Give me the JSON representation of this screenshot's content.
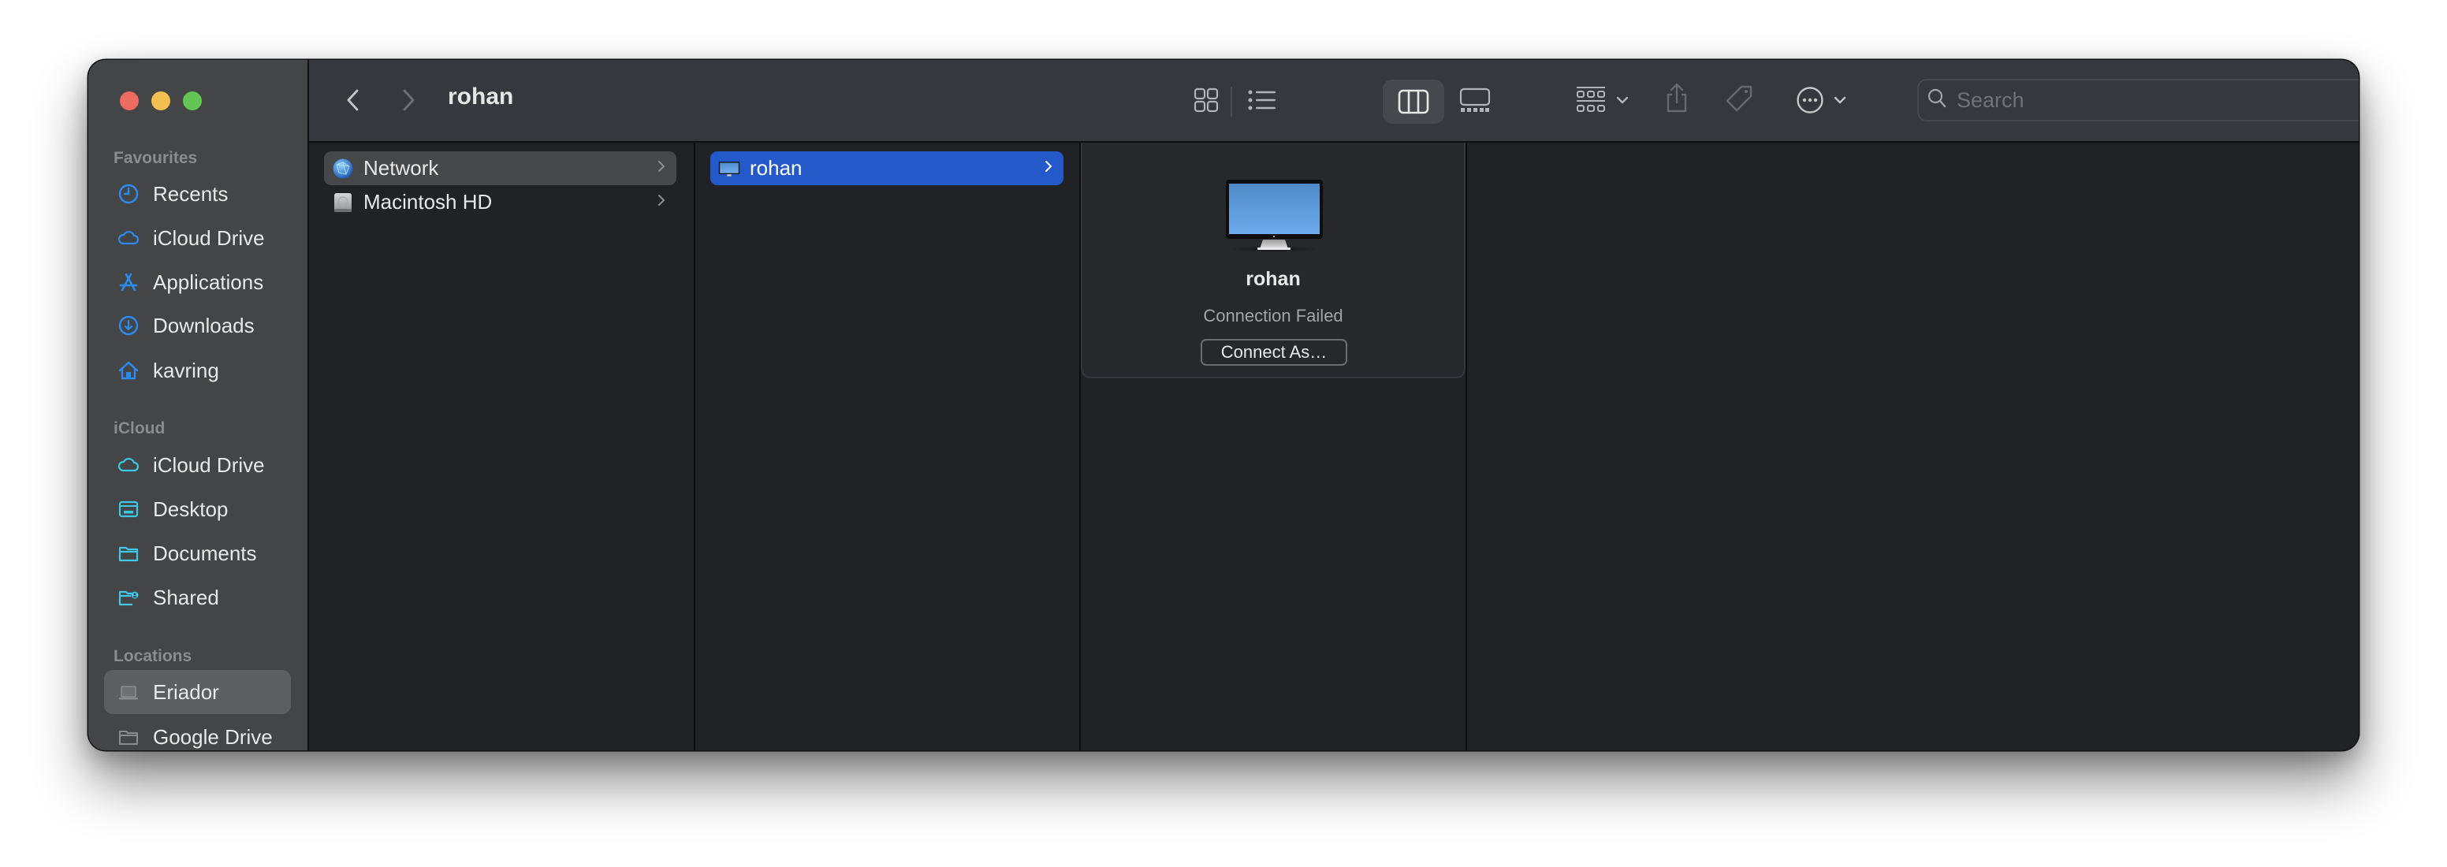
{
  "window": {
    "title": "rohan",
    "traffic_lights": {
      "close": "#ec6a5e",
      "minimize": "#f4bf4f",
      "maximize": "#61c554"
    }
  },
  "toolbar": {
    "back_icon": "chevron-left-icon",
    "forward_icon": "chevron-right-icon",
    "view_modes": [
      {
        "name": "icons",
        "icon": "grid-icon",
        "selected": false
      },
      {
        "name": "list",
        "icon": "list-icon",
        "selected": false
      },
      {
        "name": "columns",
        "icon": "columns-icon",
        "selected": true
      },
      {
        "name": "gallery",
        "icon": "gallery-icon",
        "selected": false
      }
    ],
    "group_icon": "group-icon",
    "share_icon": "share-icon",
    "tag_icon": "tag-icon",
    "more_icon": "ellipsis-circle-icon",
    "search": {
      "placeholder": "Search",
      "value": ""
    }
  },
  "sidebar": {
    "sections": [
      {
        "header": "Favourites",
        "items": [
          {
            "label": "Recents",
            "icon": "clock-icon"
          },
          {
            "label": "iCloud Drive",
            "icon": "cloud-icon"
          },
          {
            "label": "Applications",
            "icon": "applications-icon"
          },
          {
            "label": "Downloads",
            "icon": "download-icon"
          },
          {
            "label": "kavring",
            "icon": "home-icon"
          }
        ]
      },
      {
        "header": "iCloud",
        "items": [
          {
            "label": "iCloud Drive",
            "icon": "cloud-icon"
          },
          {
            "label": "Desktop",
            "icon": "desktop-icon"
          },
          {
            "label": "Documents",
            "icon": "folder-icon"
          },
          {
            "label": "Shared",
            "icon": "shared-folder-icon"
          }
        ]
      },
      {
        "header": "Locations",
        "items": [
          {
            "label": "Eriador",
            "icon": "laptop-icon",
            "selected": true
          },
          {
            "label": "Google Drive",
            "icon": "folder-icon"
          }
        ]
      }
    ],
    "accent_blue": "#2a8bf2",
    "accent_cyan": "#3cc8e8"
  },
  "columns": [
    {
      "items": [
        {
          "label": "Network",
          "icon": "network-globe-icon",
          "has_children": true,
          "selected": "inactive"
        },
        {
          "label": "Macintosh HD",
          "icon": "hard-drive-icon",
          "has_children": true
        }
      ]
    },
    {
      "items": [
        {
          "label": "rohan",
          "icon": "computer-icon",
          "has_children": true,
          "selected": "active"
        }
      ]
    }
  ],
  "preview": {
    "name": "rohan",
    "status": "Connection Failed",
    "connect_button": "Connect As…"
  },
  "selection_color": "#2459c9"
}
